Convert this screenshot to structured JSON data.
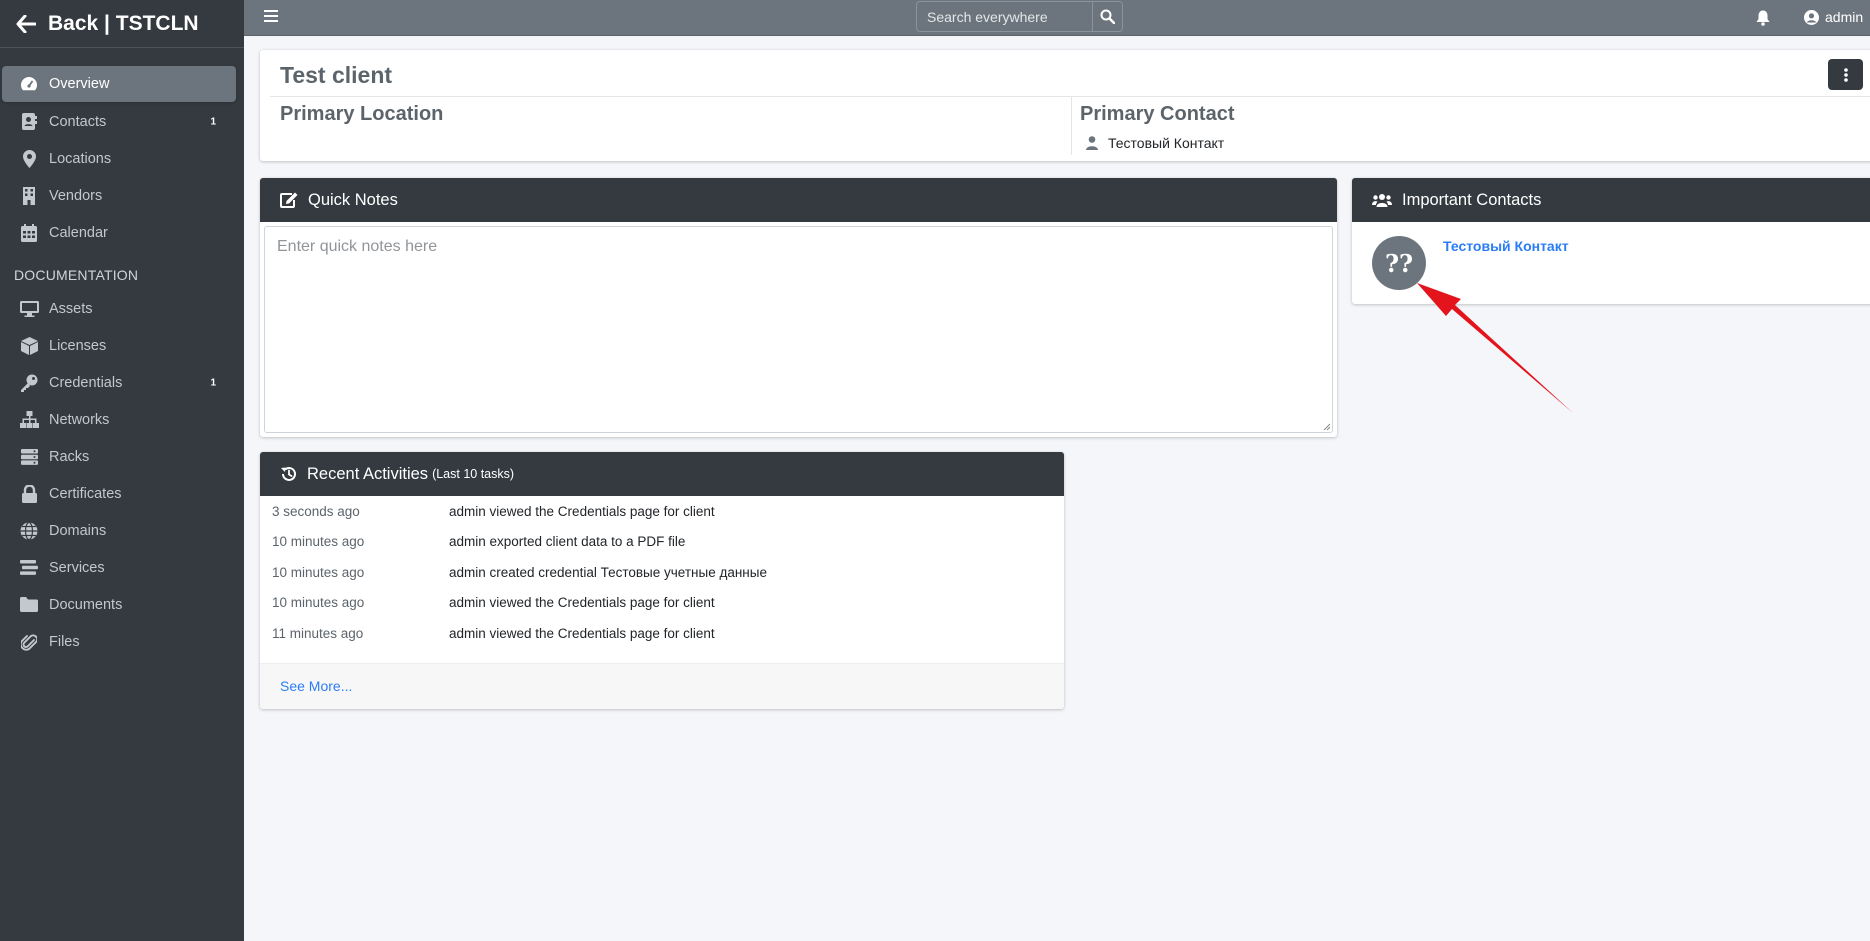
{
  "sidebar": {
    "brand": "Back | TSTCLN",
    "items": [
      {
        "label": "Overview",
        "icon": "tachometer-icon",
        "badge": ""
      },
      {
        "label": "Contacts",
        "icon": "address-book-icon",
        "badge": "1"
      },
      {
        "label": "Locations",
        "icon": "map-marker-icon",
        "badge": ""
      },
      {
        "label": "Vendors",
        "icon": "building-icon",
        "badge": ""
      },
      {
        "label": "Calendar",
        "icon": "calendar-icon",
        "badge": ""
      }
    ],
    "doc_header": "DOCUMENTATION",
    "doc_items": [
      {
        "label": "Assets",
        "icon": "desktop-icon",
        "badge": ""
      },
      {
        "label": "Licenses",
        "icon": "cube-icon",
        "badge": ""
      },
      {
        "label": "Credentials",
        "icon": "key-icon",
        "badge": "1"
      },
      {
        "label": "Networks",
        "icon": "network-icon",
        "badge": ""
      },
      {
        "label": "Racks",
        "icon": "server-icon",
        "badge": ""
      },
      {
        "label": "Certificates",
        "icon": "lock-icon",
        "badge": ""
      },
      {
        "label": "Domains",
        "icon": "globe-icon",
        "badge": ""
      },
      {
        "label": "Services",
        "icon": "stream-icon",
        "badge": ""
      },
      {
        "label": "Documents",
        "icon": "folder-icon",
        "badge": ""
      },
      {
        "label": "Files",
        "icon": "paperclip-icon",
        "badge": ""
      }
    ]
  },
  "topbar": {
    "search_placeholder": "Search everywhere",
    "user": "admin"
  },
  "client": {
    "name": "Test client",
    "primary_location_label": "Primary Location",
    "primary_contact_label": "Primary Contact",
    "primary_contact_name": "Тестовый Контакт"
  },
  "quick_notes": {
    "title": "Quick Notes",
    "placeholder": "Enter quick notes here"
  },
  "important_contacts": {
    "title": "Important Contacts",
    "avatar_text": "??",
    "contact_name": "Тестовый Контакт"
  },
  "activities": {
    "title": "Recent Activities",
    "subtitle": "(Last 10 tasks)",
    "rows": [
      {
        "time": "3 seconds ago",
        "desc": "admin viewed the Credentials page for client"
      },
      {
        "time": "10 minutes ago",
        "desc": "admin exported client data to a PDF file"
      },
      {
        "time": "10 minutes ago",
        "desc": "admin created credential Тестовые учетные данные"
      },
      {
        "time": "10 minutes ago",
        "desc": "admin viewed the Credentials page for client"
      },
      {
        "time": "11 minutes ago",
        "desc": "admin viewed the Credentials page for client"
      }
    ],
    "see_more": "See More..."
  },
  "colors": {
    "sidebar_bg": "#343a40",
    "topbar_bg": "#6c757d",
    "link": "#2b7df6",
    "annotation_arrow": "#e3141b"
  }
}
